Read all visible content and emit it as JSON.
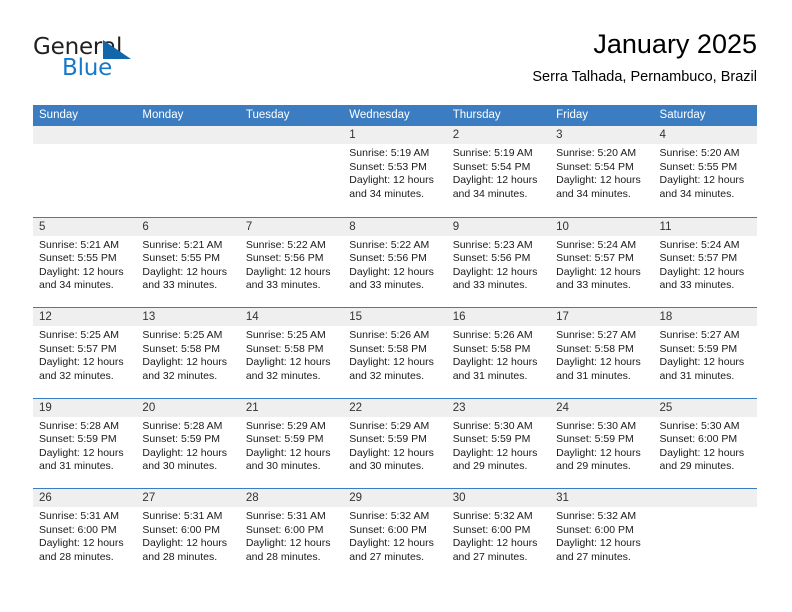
{
  "brand": {
    "name_primary": "General",
    "name_secondary": "Blue",
    "triangle_color": "#1266ab",
    "blue_color": "#1878c8"
  },
  "header": {
    "title": "January 2025",
    "subtitle": "Serra Talhada, Pernambuco, Brazil"
  },
  "theme": {
    "header_bar": "#3b7dc0",
    "day_number_bg": "#efefef",
    "text": "#1a1a1a"
  },
  "weekdays": [
    "Sunday",
    "Monday",
    "Tuesday",
    "Wednesday",
    "Thursday",
    "Friday",
    "Saturday"
  ],
  "weeks": [
    [
      {
        "day": "",
        "lines": []
      },
      {
        "day": "",
        "lines": []
      },
      {
        "day": "",
        "lines": []
      },
      {
        "day": "1",
        "lines": [
          "Sunrise: 5:19 AM",
          "Sunset: 5:53 PM",
          "Daylight: 12 hours",
          "and 34 minutes."
        ]
      },
      {
        "day": "2",
        "lines": [
          "Sunrise: 5:19 AM",
          "Sunset: 5:54 PM",
          "Daylight: 12 hours",
          "and 34 minutes."
        ]
      },
      {
        "day": "3",
        "lines": [
          "Sunrise: 5:20 AM",
          "Sunset: 5:54 PM",
          "Daylight: 12 hours",
          "and 34 minutes."
        ]
      },
      {
        "day": "4",
        "lines": [
          "Sunrise: 5:20 AM",
          "Sunset: 5:55 PM",
          "Daylight: 12 hours",
          "and 34 minutes."
        ]
      }
    ],
    [
      {
        "day": "5",
        "lines": [
          "Sunrise: 5:21 AM",
          "Sunset: 5:55 PM",
          "Daylight: 12 hours",
          "and 34 minutes."
        ]
      },
      {
        "day": "6",
        "lines": [
          "Sunrise: 5:21 AM",
          "Sunset: 5:55 PM",
          "Daylight: 12 hours",
          "and 33 minutes."
        ]
      },
      {
        "day": "7",
        "lines": [
          "Sunrise: 5:22 AM",
          "Sunset: 5:56 PM",
          "Daylight: 12 hours",
          "and 33 minutes."
        ]
      },
      {
        "day": "8",
        "lines": [
          "Sunrise: 5:22 AM",
          "Sunset: 5:56 PM",
          "Daylight: 12 hours",
          "and 33 minutes."
        ]
      },
      {
        "day": "9",
        "lines": [
          "Sunrise: 5:23 AM",
          "Sunset: 5:56 PM",
          "Daylight: 12 hours",
          "and 33 minutes."
        ]
      },
      {
        "day": "10",
        "lines": [
          "Sunrise: 5:24 AM",
          "Sunset: 5:57 PM",
          "Daylight: 12 hours",
          "and 33 minutes."
        ]
      },
      {
        "day": "11",
        "lines": [
          "Sunrise: 5:24 AM",
          "Sunset: 5:57 PM",
          "Daylight: 12 hours",
          "and 33 minutes."
        ]
      }
    ],
    [
      {
        "day": "12",
        "lines": [
          "Sunrise: 5:25 AM",
          "Sunset: 5:57 PM",
          "Daylight: 12 hours",
          "and 32 minutes."
        ]
      },
      {
        "day": "13",
        "lines": [
          "Sunrise: 5:25 AM",
          "Sunset: 5:58 PM",
          "Daylight: 12 hours",
          "and 32 minutes."
        ]
      },
      {
        "day": "14",
        "lines": [
          "Sunrise: 5:25 AM",
          "Sunset: 5:58 PM",
          "Daylight: 12 hours",
          "and 32 minutes."
        ]
      },
      {
        "day": "15",
        "lines": [
          "Sunrise: 5:26 AM",
          "Sunset: 5:58 PM",
          "Daylight: 12 hours",
          "and 32 minutes."
        ]
      },
      {
        "day": "16",
        "lines": [
          "Sunrise: 5:26 AM",
          "Sunset: 5:58 PM",
          "Daylight: 12 hours",
          "and 31 minutes."
        ]
      },
      {
        "day": "17",
        "lines": [
          "Sunrise: 5:27 AM",
          "Sunset: 5:58 PM",
          "Daylight: 12 hours",
          "and 31 minutes."
        ]
      },
      {
        "day": "18",
        "lines": [
          "Sunrise: 5:27 AM",
          "Sunset: 5:59 PM",
          "Daylight: 12 hours",
          "and 31 minutes."
        ]
      }
    ],
    [
      {
        "day": "19",
        "lines": [
          "Sunrise: 5:28 AM",
          "Sunset: 5:59 PM",
          "Daylight: 12 hours",
          "and 31 minutes."
        ]
      },
      {
        "day": "20",
        "lines": [
          "Sunrise: 5:28 AM",
          "Sunset: 5:59 PM",
          "Daylight: 12 hours",
          "and 30 minutes."
        ]
      },
      {
        "day": "21",
        "lines": [
          "Sunrise: 5:29 AM",
          "Sunset: 5:59 PM",
          "Daylight: 12 hours",
          "and 30 minutes."
        ]
      },
      {
        "day": "22",
        "lines": [
          "Sunrise: 5:29 AM",
          "Sunset: 5:59 PM",
          "Daylight: 12 hours",
          "and 30 minutes."
        ]
      },
      {
        "day": "23",
        "lines": [
          "Sunrise: 5:30 AM",
          "Sunset: 5:59 PM",
          "Daylight: 12 hours",
          "and 29 minutes."
        ]
      },
      {
        "day": "24",
        "lines": [
          "Sunrise: 5:30 AM",
          "Sunset: 5:59 PM",
          "Daylight: 12 hours",
          "and 29 minutes."
        ]
      },
      {
        "day": "25",
        "lines": [
          "Sunrise: 5:30 AM",
          "Sunset: 6:00 PM",
          "Daylight: 12 hours",
          "and 29 minutes."
        ]
      }
    ],
    [
      {
        "day": "26",
        "lines": [
          "Sunrise: 5:31 AM",
          "Sunset: 6:00 PM",
          "Daylight: 12 hours",
          "and 28 minutes."
        ]
      },
      {
        "day": "27",
        "lines": [
          "Sunrise: 5:31 AM",
          "Sunset: 6:00 PM",
          "Daylight: 12 hours",
          "and 28 minutes."
        ]
      },
      {
        "day": "28",
        "lines": [
          "Sunrise: 5:31 AM",
          "Sunset: 6:00 PM",
          "Daylight: 12 hours",
          "and 28 minutes."
        ]
      },
      {
        "day": "29",
        "lines": [
          "Sunrise: 5:32 AM",
          "Sunset: 6:00 PM",
          "Daylight: 12 hours",
          "and 27 minutes."
        ]
      },
      {
        "day": "30",
        "lines": [
          "Sunrise: 5:32 AM",
          "Sunset: 6:00 PM",
          "Daylight: 12 hours",
          "and 27 minutes."
        ]
      },
      {
        "day": "31",
        "lines": [
          "Sunrise: 5:32 AM",
          "Sunset: 6:00 PM",
          "Daylight: 12 hours",
          "and 27 minutes."
        ]
      },
      {
        "day": "",
        "lines": []
      }
    ]
  ]
}
